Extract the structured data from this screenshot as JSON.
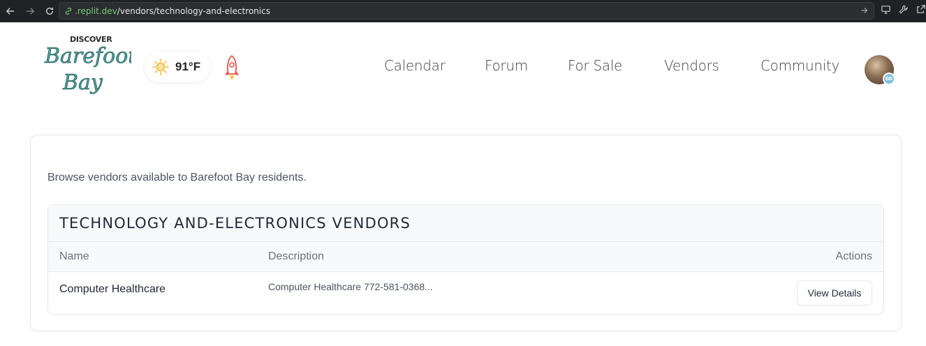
{
  "browser": {
    "url_host": ".replit.dev",
    "url_path": "/vendors/technology-and-electronics"
  },
  "header": {
    "logo_top": "DISCOVER",
    "logo_line1": "Barefoot",
    "logo_line2": "Bay",
    "weather": {
      "temp": "91°F",
      "icon": "sun-icon"
    },
    "nav": {
      "calendar": "Calendar",
      "forum": "Forum",
      "for_sale": "For Sale",
      "vendors": "Vendors",
      "community": "Community"
    },
    "avatar_badge": "BB"
  },
  "main": {
    "intro": "Browse vendors available to Barefoot Bay residents.",
    "panel_title": "TECHNOLOGY AND-ELECTRONICS VENDORS",
    "columns": {
      "name": "Name",
      "description": "Description",
      "actions": "Actions"
    },
    "rows": [
      {
        "name": "Computer Healthcare",
        "description": "Computer Healthcare 772-581-0368...",
        "action": "View Details"
      }
    ]
  },
  "colors": {
    "browser_bar": "#202124",
    "url_host": "#6fcf6f",
    "logo_teal": "#4a9a96",
    "nav_text": "#3b3f46",
    "sun": "#f5b731",
    "rocket": "#e8524a"
  }
}
